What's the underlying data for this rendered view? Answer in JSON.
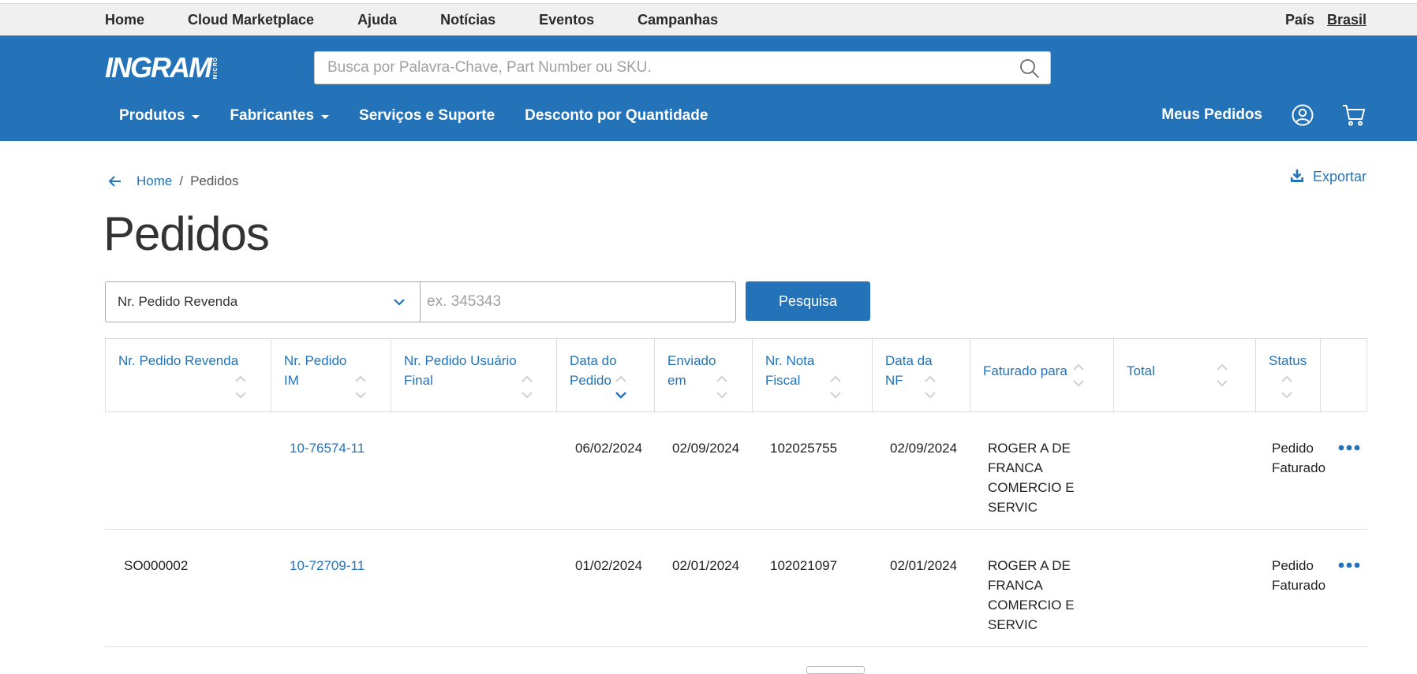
{
  "topbar": {
    "links": [
      "Home",
      "Cloud Marketplace",
      "Ajuda",
      "Notícias",
      "Eventos",
      "Campanhas"
    ],
    "country_label": "País",
    "country_value": "Brasil"
  },
  "header": {
    "logo_word": "INGRAM",
    "logo_micro": "MICRO",
    "search_placeholder": "Busca por Palavra-Chave, Part Number ou SKU.",
    "nav": [
      "Produtos",
      "Fabricantes",
      "Serviços e Suporte",
      "Desconto por Quantidade"
    ],
    "orders_label": "Meus Pedidos"
  },
  "breadcrumb": {
    "home": "Home",
    "sep": "/",
    "current": "Pedidos"
  },
  "export_label": "Exportar",
  "page_title": "Pedidos",
  "filter": {
    "selected": "Nr. Pedido Revenda",
    "placeholder": "ex. 345343",
    "button": "Pesquisa"
  },
  "table": {
    "columns": [
      [
        "Nr. Pedido Revenda"
      ],
      [
        "Nr. Pedido",
        "IM"
      ],
      [
        "Nr. Pedido Usuário",
        "Final"
      ],
      [
        "Data do",
        "Pedido"
      ],
      [
        "Enviado",
        "em"
      ],
      [
        "Nr. Nota",
        "Fiscal"
      ],
      [
        "Data da",
        "NF"
      ],
      [
        "Faturado para"
      ],
      [
        "Total"
      ],
      [
        "Status"
      ],
      [
        ""
      ]
    ],
    "rows": [
      {
        "revenda": "",
        "im": "10-76574-11",
        "usuario_final": "",
        "data_pedido": "06/02/2024",
        "enviado": "02/09/2024",
        "nota": "102025755",
        "data_nf": "02/09/2024",
        "faturado": [
          "ROGER A DE",
          "FRANCA",
          "COMERCIO E",
          "SERVIC"
        ],
        "total": "",
        "status": [
          "Pedido",
          "Faturado"
        ]
      },
      {
        "revenda": "SO000002",
        "im": "10-72709-11",
        "usuario_final": "",
        "data_pedido": "01/02/2024",
        "enviado": "02/01/2024",
        "nota": "102021097",
        "data_nf": "02/01/2024",
        "faturado": [
          "ROGER A DE",
          "FRANCA",
          "COMERCIO E",
          "SERVIC"
        ],
        "total": "",
        "status": [
          "Pedido",
          "Faturado"
        ]
      }
    ]
  },
  "colors": {
    "brand_blue": "#2473b8",
    "topbar_bg": "#f0f0f0",
    "border": "#dcdcdc"
  }
}
